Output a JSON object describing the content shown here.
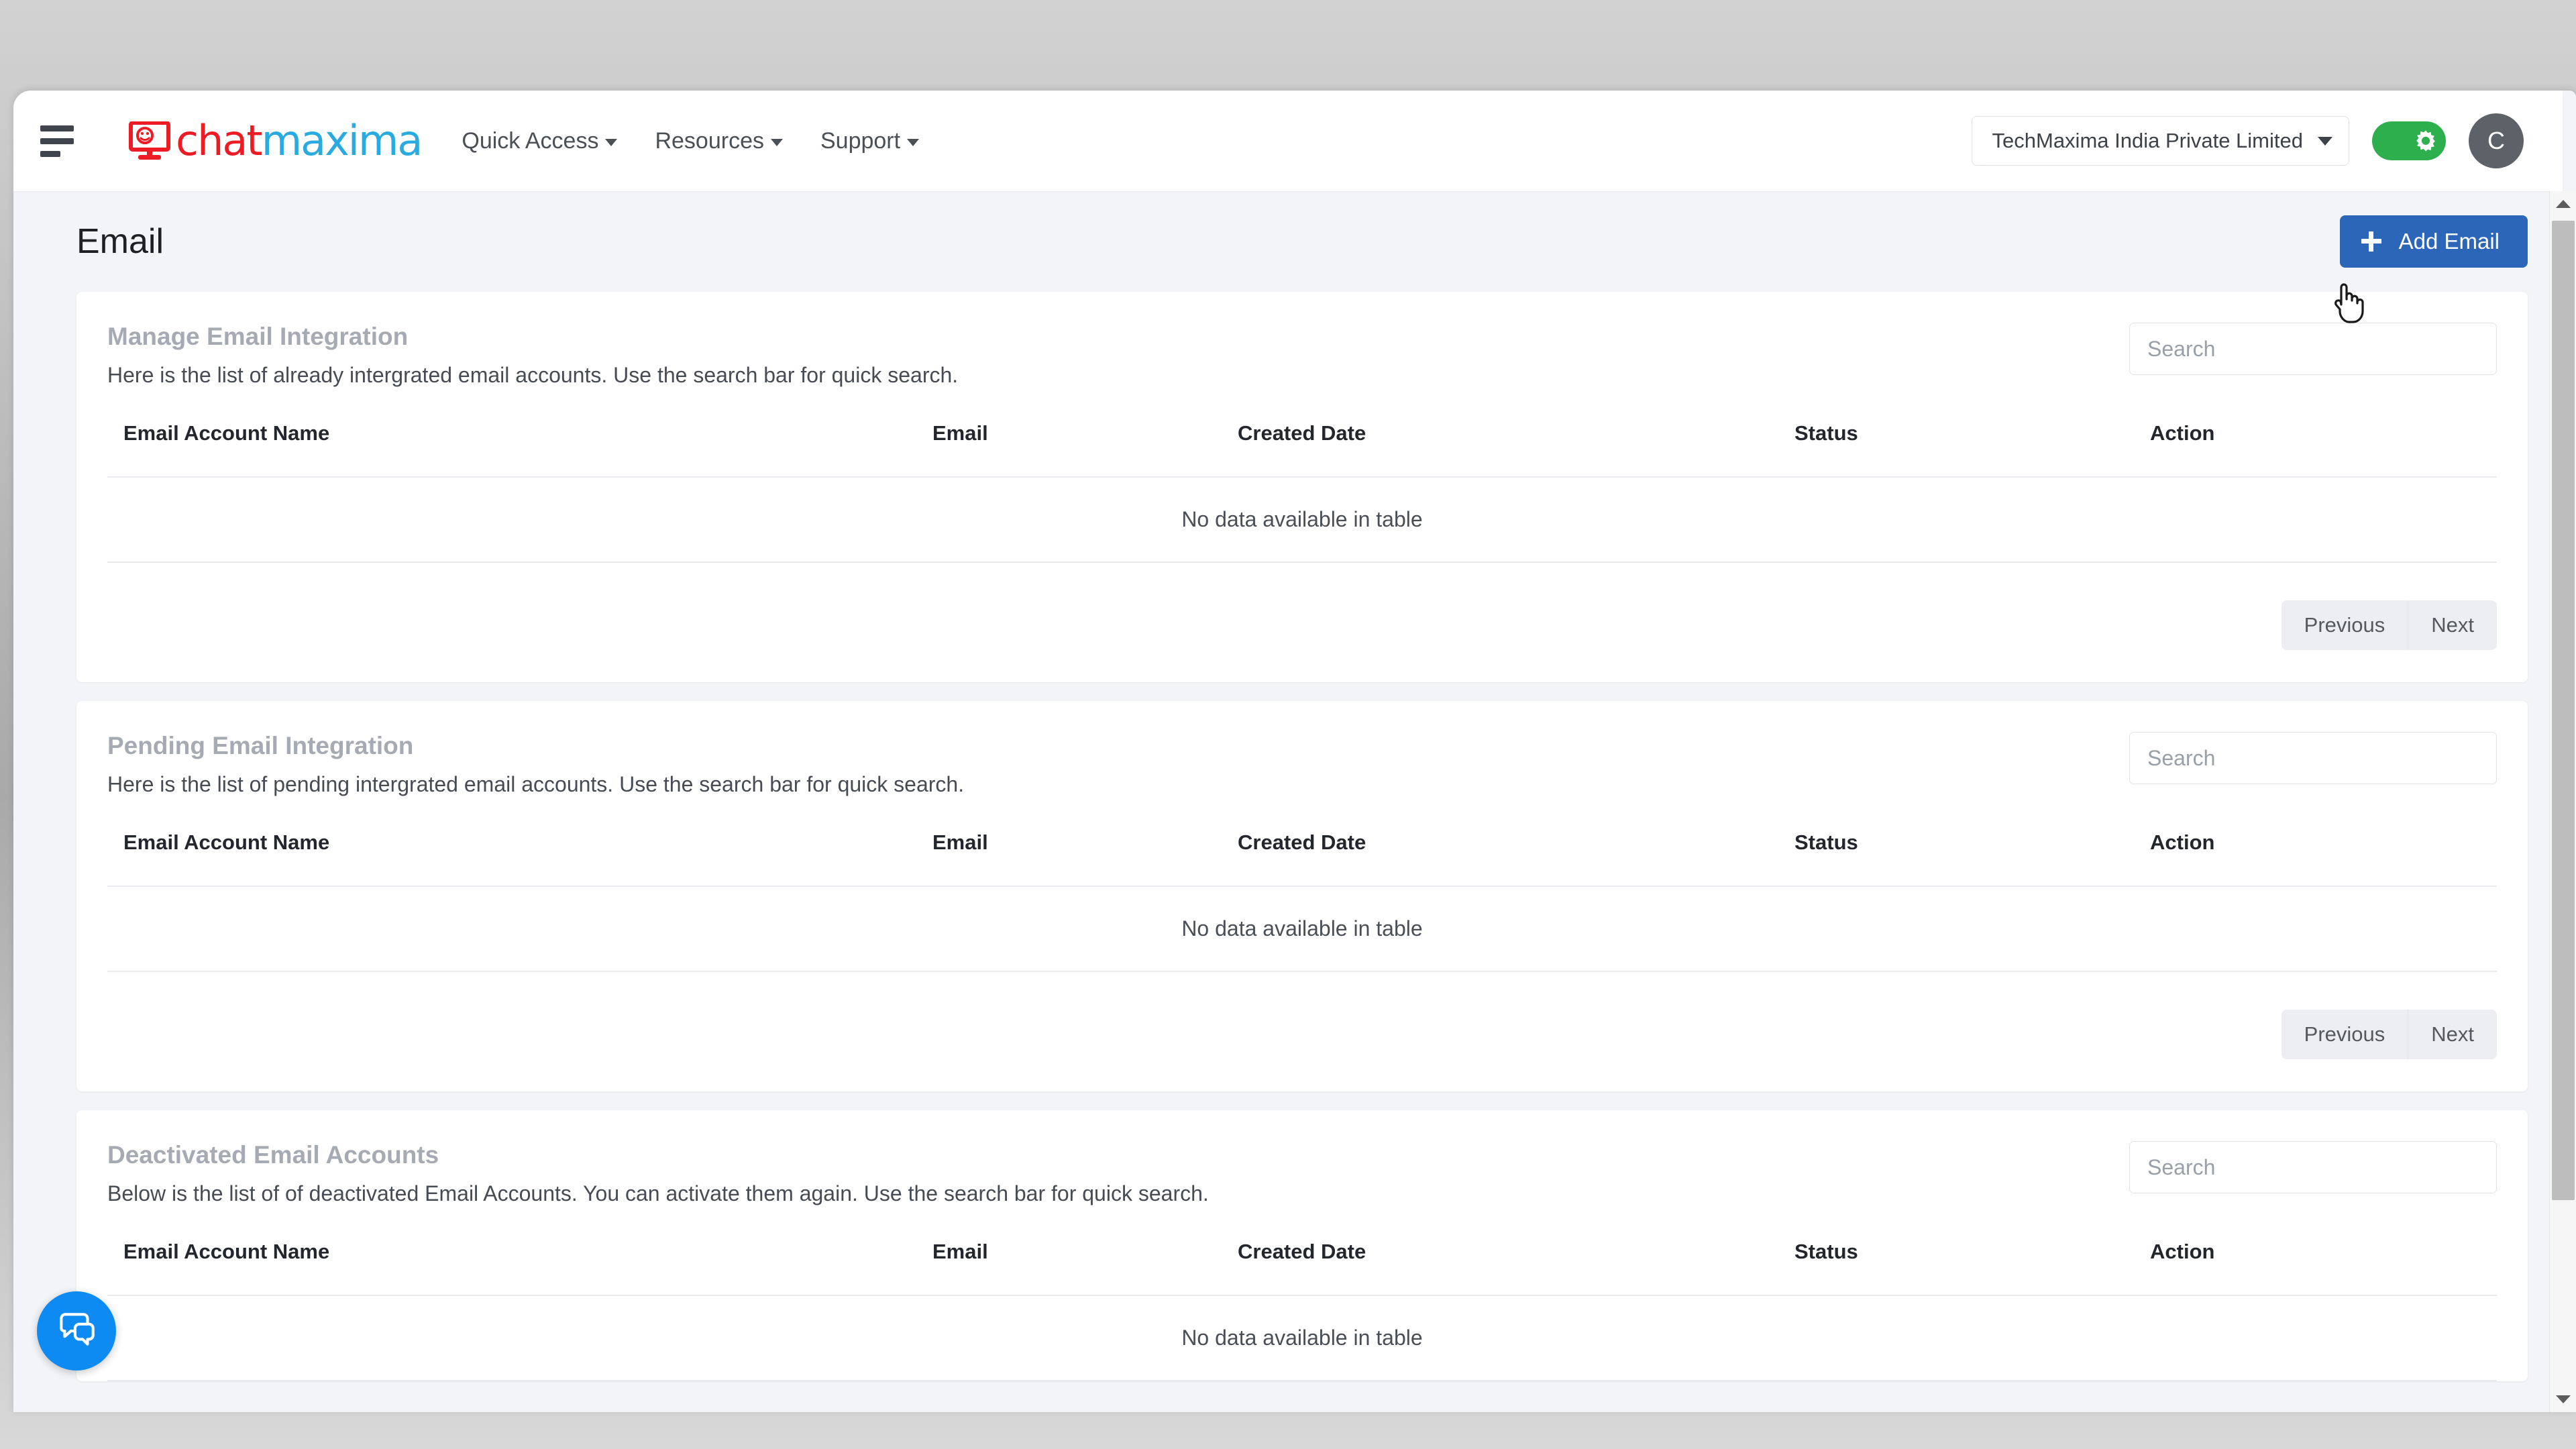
{
  "header": {
    "menu_icon": "hamburger-icon",
    "logo": {
      "part1": "chat",
      "part2": "maxima",
      "mark": "monitor-smiley-icon"
    },
    "nav": [
      {
        "label": "Quick Access",
        "icon": "chevron-down-icon"
      },
      {
        "label": "Resources",
        "icon": "chevron-down-icon"
      },
      {
        "label": "Support",
        "icon": "chevron-down-icon"
      }
    ],
    "org_selector": {
      "value": "TechMaxima India Private Limited",
      "icon": "chevron-down-icon"
    },
    "settings_toggle": {
      "icon": "gear-icon",
      "color": "#2eaf4e",
      "state": "on"
    },
    "avatar": {
      "initial": "C",
      "color": "#5d6168"
    }
  },
  "page": {
    "title": "Email",
    "add_button": {
      "label": "Add Email",
      "icon": "plus-icon",
      "color": "#2c66b8"
    }
  },
  "table_columns": [
    "Email Account Name",
    "Email",
    "Created Date",
    "Status",
    "Action"
  ],
  "empty_message": "No data available in table",
  "pagination": {
    "previous": "Previous",
    "next": "Next"
  },
  "search": {
    "placeholder": "Search",
    "value": ""
  },
  "sections": [
    {
      "title": "Manage Email Integration",
      "subtitle": "Here is the list of already intergrated email accounts. Use the search bar for quick search."
    },
    {
      "title": "Pending Email Integration",
      "subtitle": "Here is the list of pending intergrated email accounts. Use the search bar for quick search."
    },
    {
      "title": "Deactivated Email Accounts",
      "subtitle": "Below is the list of of deactivated Email Accounts. You can activate them again. Use the search bar for quick search."
    }
  ],
  "chat_widget": {
    "icon": "chat-bubbles-icon",
    "color": "#0d8bf2"
  },
  "scrollbar": {
    "up_icon": "triangle-up-icon",
    "down_icon": "triangle-down-icon"
  },
  "cursor": {
    "icon": "pointer-hand-cursor"
  }
}
